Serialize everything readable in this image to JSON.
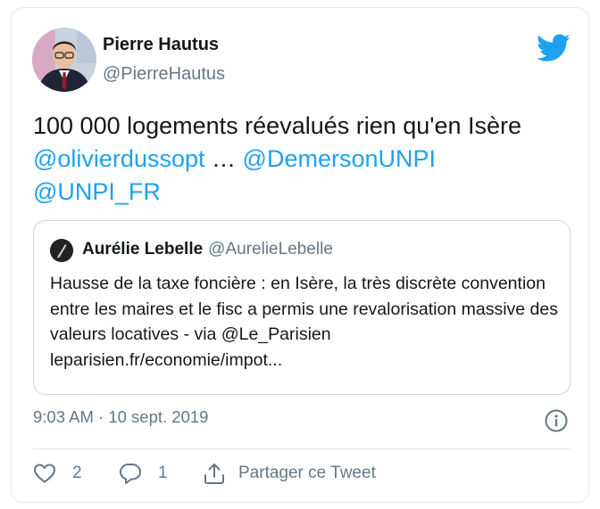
{
  "tweet": {
    "author": {
      "name": "Pierre Hautus",
      "handle": "@PierreHautus"
    },
    "text": "100 000 logements réevalués rien qu'en Isère",
    "mentions": [
      "@olivierdussopt",
      "…",
      "@DemersonUNPI",
      "@UNPI_FR"
    ],
    "timestamp": "9:03 AM · 10 sept. 2019"
  },
  "quoted": {
    "author_name": "Aurélie Lebelle",
    "author_handle": "@AurelieLebelle",
    "text": "Hausse de la taxe foncière : en Isère, la très discrète convention entre les maires et le fisc a permis une revalorisation massive des valeurs locatives - via @Le_Parisien leparisien.fr/economie/impot..."
  },
  "actions": {
    "likes": "2",
    "replies": "1",
    "share_label": "Partager ce Tweet"
  },
  "colors": {
    "accent": "#1da1f2",
    "text": "#14171a",
    "secondary": "#657786",
    "border": "#e1e8ed"
  },
  "icons": [
    "twitter-bird-icon",
    "info-icon",
    "heart-icon",
    "reply-bubble-icon",
    "share-icon"
  ]
}
